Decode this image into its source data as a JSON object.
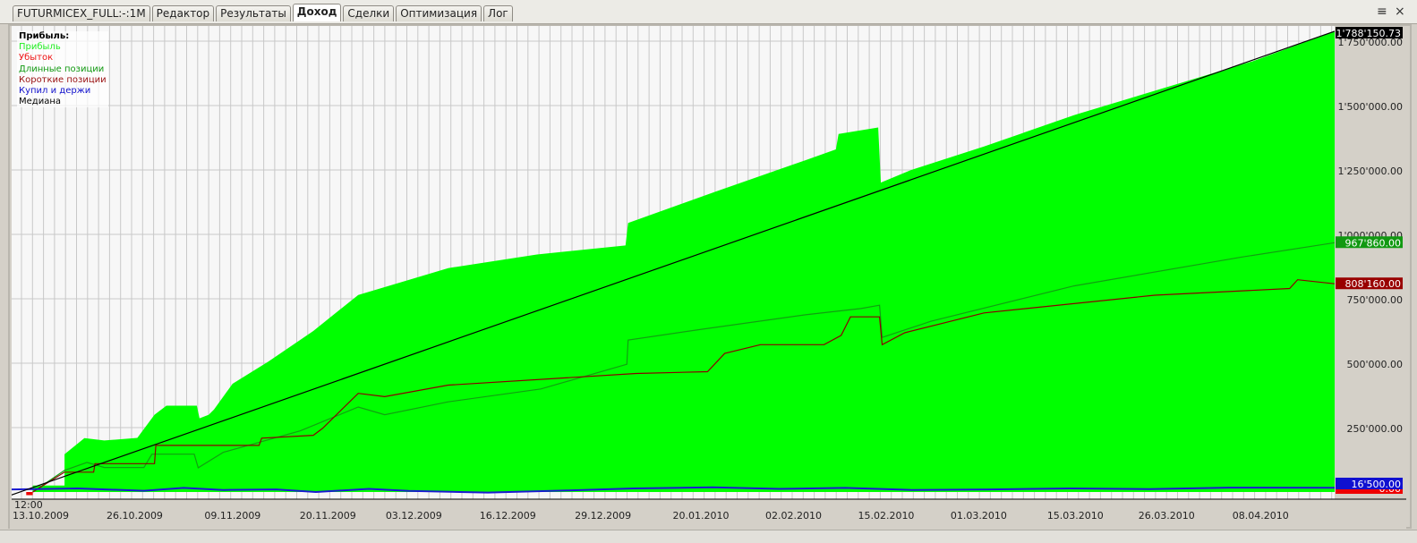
{
  "tabs": [
    "FUTURMICEX_FULL:-:1M",
    "Редактор",
    "Результаты",
    "Доход",
    "Сделки",
    "Оптимизация",
    "Лог"
  ],
  "active_tab": 3,
  "window_controls": {
    "pin": "≡",
    "close": "×"
  },
  "legend": {
    "title": "Прибыль:",
    "items": [
      {
        "label": "Прибыль",
        "color": "#22ee22"
      },
      {
        "label": "Убыток",
        "color": "#ee1111"
      },
      {
        "label": "Длинные позиции",
        "color": "#119911"
      },
      {
        "label": "Короткие позиции",
        "color": "#991111"
      },
      {
        "label": "Купил и держи",
        "color": "#1111cc"
      },
      {
        "label": "Медиана",
        "color": "#000000"
      }
    ]
  },
  "chart_data": {
    "type": "area",
    "x_unit": "bar index (0-100 across period)",
    "ylim": [
      -10000,
      1820000
    ],
    "y_ticks": [
      {
        "v": 250000,
        "label": "250'000.00"
      },
      {
        "v": 500000,
        "label": "500'000.00"
      },
      {
        "v": 750000,
        "label": "750'000.00"
      },
      {
        "v": 1000000,
        "label": "1'000'000.00"
      },
      {
        "v": 1250000,
        "label": "1'250'000.00"
      },
      {
        "v": 1500000,
        "label": "1'500'000.00"
      },
      {
        "v": 1750000,
        "label": "1'750'000.00"
      }
    ],
    "x_time_label": "12:00",
    "x_ticks": [
      {
        "x": 2.2,
        "label": "13.10.2009"
      },
      {
        "x": 9.3,
        "label": "26.10.2009"
      },
      {
        "x": 16.7,
        "label": "09.11.2009"
      },
      {
        "x": 23.9,
        "label": "20.11.2009"
      },
      {
        "x": 30.4,
        "label": "03.12.2009"
      },
      {
        "x": 37.5,
        "label": "16.12.2009"
      },
      {
        "x": 44.7,
        "label": "29.12.2009"
      },
      {
        "x": 52.1,
        "label": "20.01.2010"
      },
      {
        "x": 59.1,
        "label": "02.02.2010"
      },
      {
        "x": 66.1,
        "label": "15.02.2010"
      },
      {
        "x": 73.1,
        "label": "01.03.2010"
      },
      {
        "x": 80.4,
        "label": "15.03.2010"
      },
      {
        "x": 87.3,
        "label": "26.03.2010"
      },
      {
        "x": 94.4,
        "label": "08.04.2010"
      }
    ],
    "series": [
      {
        "name": "Прибыль",
        "kind": "area",
        "color": "#00ff00",
        "points": [
          [
            0,
            0
          ],
          [
            1.6,
            0
          ],
          [
            1.6,
            25000
          ],
          [
            4,
            25000
          ],
          [
            4,
            147000
          ],
          [
            5.5,
            209000
          ],
          [
            7,
            200000
          ],
          [
            9.5,
            210000
          ],
          [
            10.8,
            300000
          ],
          [
            11.7,
            335000
          ],
          [
            14,
            335000
          ],
          [
            14.2,
            286000
          ],
          [
            14.9,
            300000
          ],
          [
            15.3,
            320000
          ],
          [
            16.7,
            420000
          ],
          [
            19.4,
            506000
          ],
          [
            22.8,
            625000
          ],
          [
            26.2,
            765000
          ],
          [
            29.6,
            817000
          ],
          [
            33,
            869000
          ],
          [
            39.7,
            922000
          ],
          [
            46.4,
            957000
          ],
          [
            46.6,
            1044000
          ],
          [
            53.2,
            1166000
          ],
          [
            60,
            1288000
          ],
          [
            62.3,
            1330000
          ],
          [
            62.5,
            1390000
          ],
          [
            65.5,
            1415000
          ],
          [
            65.7,
            1201000
          ],
          [
            68,
            1250000
          ],
          [
            73.5,
            1341000
          ],
          [
            80.3,
            1463000
          ],
          [
            87.1,
            1568000
          ],
          [
            93.8,
            1672000
          ],
          [
            100,
            1788150
          ]
        ]
      },
      {
        "name": "Длинные позиции",
        "kind": "line",
        "color": "#11a011",
        "last": "967'860.00",
        "points": [
          [
            1.6,
            0
          ],
          [
            4,
            84000
          ],
          [
            5.7,
            115000
          ],
          [
            7,
            95000
          ],
          [
            10,
            95000
          ],
          [
            10.6,
            147000
          ],
          [
            13.8,
            147000
          ],
          [
            14.1,
            94000
          ],
          [
            16,
            154000
          ],
          [
            21.8,
            237000
          ],
          [
            26.2,
            330000
          ],
          [
            28.2,
            300000
          ],
          [
            33,
            350000
          ],
          [
            40,
            400000
          ],
          [
            46.5,
            496000
          ],
          [
            46.6,
            590000
          ],
          [
            52.2,
            632000
          ],
          [
            60,
            688000
          ],
          [
            64.2,
            712000
          ],
          [
            65.6,
            725000
          ],
          [
            65.8,
            600000
          ],
          [
            69.5,
            663000
          ],
          [
            80.3,
            800000
          ],
          [
            93,
            912000
          ],
          [
            100,
            967860
          ]
        ]
      },
      {
        "name": "Короткие позиции",
        "kind": "line",
        "color": "#8b0000",
        "last": "808'160.00",
        "points": [
          [
            1.6,
            0
          ],
          [
            4,
            77000
          ],
          [
            6.2,
            77000
          ],
          [
            6.3,
            110000
          ],
          [
            10.8,
            110000
          ],
          [
            10.9,
            181000
          ],
          [
            18.7,
            181000
          ],
          [
            18.9,
            209000
          ],
          [
            22.8,
            220000
          ],
          [
            23.5,
            247000
          ],
          [
            26.2,
            383000
          ],
          [
            28.2,
            370000
          ],
          [
            33,
            415000
          ],
          [
            47.2,
            460000
          ],
          [
            52.6,
            467000
          ],
          [
            53.9,
            538000
          ],
          [
            56.6,
            572000
          ],
          [
            61.4,
            572000
          ],
          [
            62.7,
            608000
          ],
          [
            63.4,
            680000
          ],
          [
            65.6,
            680000
          ],
          [
            65.8,
            572000
          ],
          [
            67.5,
            618000
          ],
          [
            73.5,
            695000
          ],
          [
            86.4,
            764000
          ],
          [
            96.6,
            790000
          ],
          [
            97.2,
            824000
          ],
          [
            100,
            808160
          ]
        ]
      },
      {
        "name": "Купил и держи",
        "kind": "line",
        "color": "#1a1ad0",
        "last": "16'500.00",
        "points": [
          [
            0,
            10000
          ],
          [
            5,
            14000
          ],
          [
            10,
            5000
          ],
          [
            13,
            16000
          ],
          [
            16,
            8000
          ],
          [
            20,
            10000
          ],
          [
            23,
            0
          ],
          [
            27,
            12000
          ],
          [
            30,
            4000
          ],
          [
            36,
            -2000
          ],
          [
            42,
            6000
          ],
          [
            47,
            14000
          ],
          [
            53,
            18000
          ],
          [
            58,
            12000
          ],
          [
            63,
            16000
          ],
          [
            68,
            8000
          ],
          [
            74,
            10000
          ],
          [
            80,
            14000
          ],
          [
            86,
            11000
          ],
          [
            92,
            17000
          ],
          [
            100,
            16500
          ]
        ]
      },
      {
        "name": "Убыток",
        "kind": "area",
        "color": "#ee0000",
        "last": "0.00",
        "points": [
          [
            1.1,
            0
          ],
          [
            1.1,
            -12000
          ],
          [
            1.6,
            -12000
          ],
          [
            1.6,
            0
          ]
        ]
      },
      {
        "name": "Медиана",
        "kind": "line",
        "color": "#000000",
        "last": "1'788'150.73",
        "points": [
          [
            -0.5,
            -20000
          ],
          [
            100,
            1788150
          ]
        ]
      }
    ]
  }
}
